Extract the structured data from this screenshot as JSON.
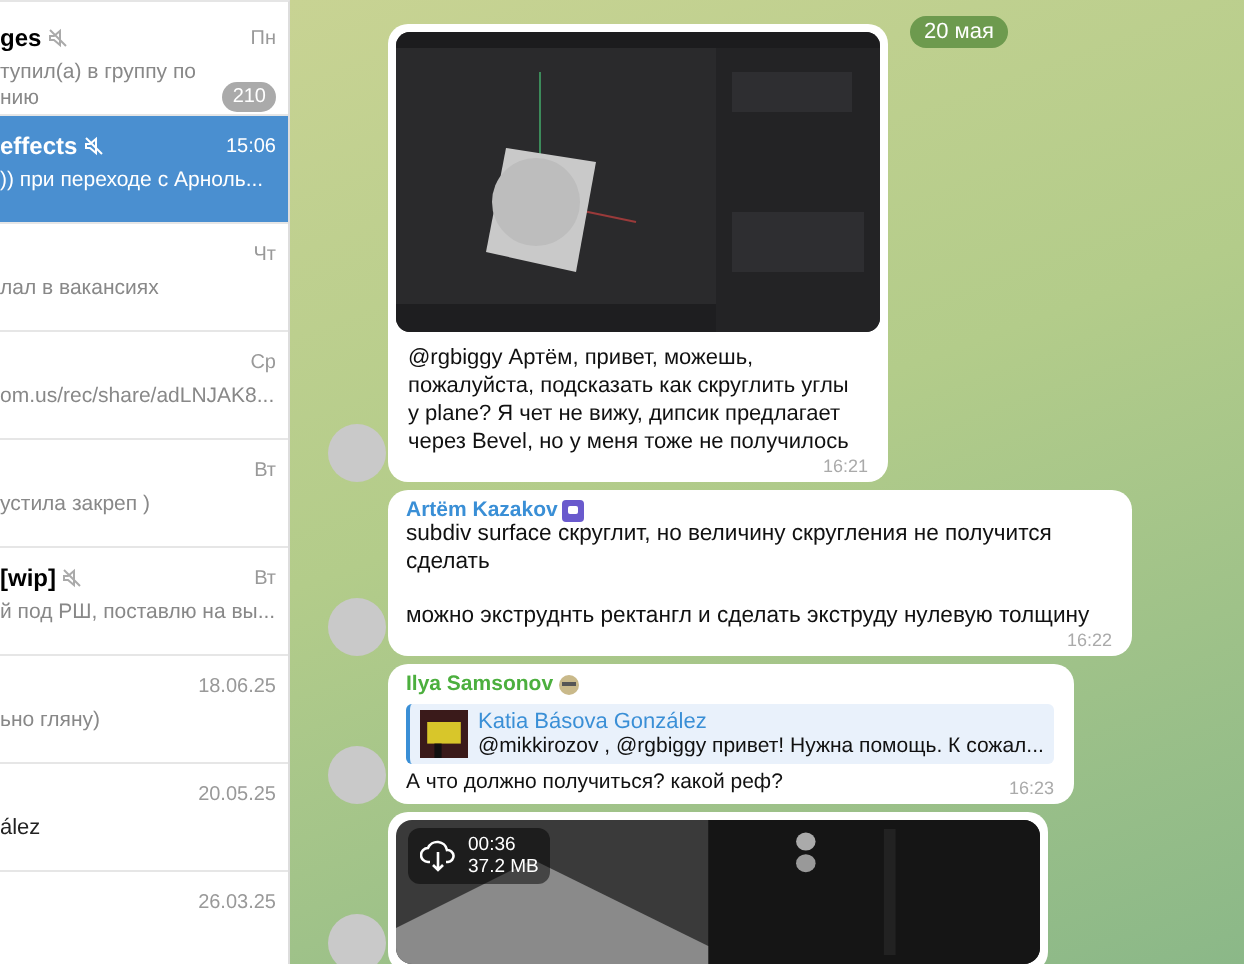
{
  "chats": [
    {
      "title": "ges",
      "muted": true,
      "time": "Пн",
      "preview": [
        "тупил(а) в группу по",
        "нию"
      ],
      "badge": "210",
      "selected": false
    },
    {
      "title": "effects",
      "muted": true,
      "time": "15:06",
      "preview": [
        ")) при переходе с Арноль..."
      ],
      "selected": true
    },
    {
      "time": "Чт",
      "preview": [
        "лал в вакансиях"
      ],
      "selected": false
    },
    {
      "time": "Ср",
      "preview": [
        "om.us/rec/share/adLNJAK8..."
      ],
      "selected": false
    },
    {
      "time": "Вт",
      "preview": [
        "устила закреп )"
      ],
      "selected": false
    },
    {
      "title": "[wip]",
      "muted": true,
      "time": "Вт",
      "preview": [
        "й под РШ, поставлю на вы..."
      ],
      "selected": false
    },
    {
      "time": "18.06.25",
      "preview": [
        "ьно гляну)"
      ],
      "selected": false
    },
    {
      "time": "20.05.25",
      "sender": "ález",
      "selected": false
    },
    {
      "time": "26.03.25",
      "selected": false
    }
  ],
  "date_pill": "20 мая",
  "messages": [
    {
      "text": "@rgbiggy Артём, привет, можешь, пожалуйста, подсказать как скруглить углы у plane? Я чет не вижу, дипсик предлагает через Bevel, но у меня тоже не получилось",
      "time": "16:21"
    },
    {
      "kind": "text",
      "sender": "Artëm Kazakov",
      "color": "#3a8fd6",
      "text": "subdiv surface скруглит, но величину скругления не получится сделать\n\nможно экструднть ректангл и сделать экструду нулевую толщину",
      "time": "16:22"
    },
    {
      "kind": "reply",
      "sender": "Ilya Samsonov",
      "color": "#4caf3e",
      "reply": {
        "author": "Katia Básova González",
        "text": "@mikkirozov , @rgbiggy привет! Нужна помощь. К сожал..."
      },
      "text": "А что должно получиться? какой реф?",
      "time": "16:23"
    },
    {
      "kind": "video",
      "duration": "00:36",
      "size": "37.2 MB"
    }
  ]
}
